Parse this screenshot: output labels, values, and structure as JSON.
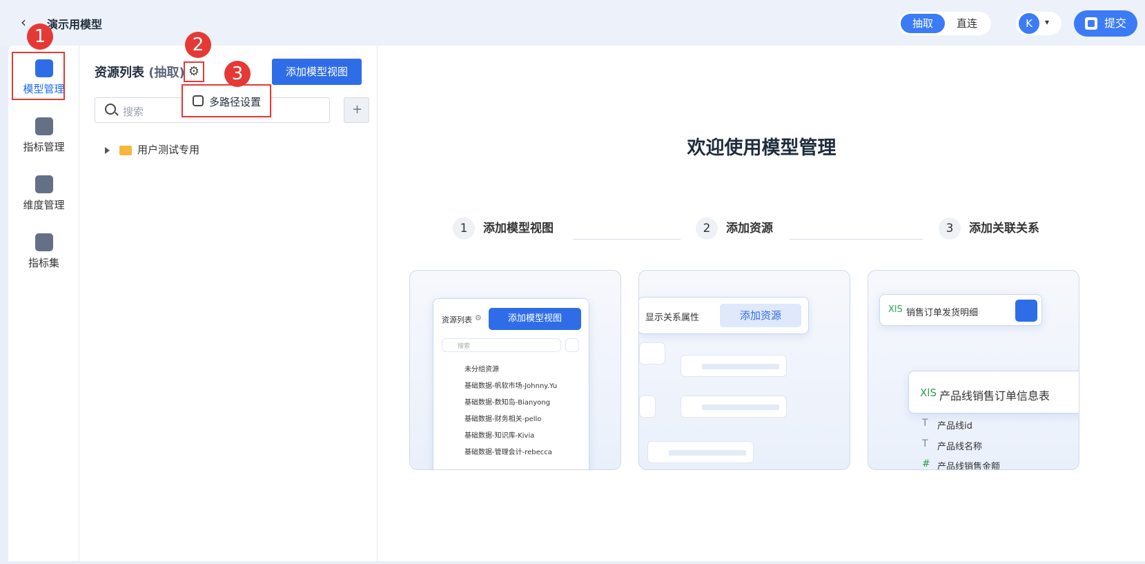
{
  "topbar": {
    "back_icon": "chevron-left-icon",
    "title": "演示用模型",
    "mode_options": [
      "抽取",
      "直连"
    ],
    "mode_active": "抽取",
    "user_initial": "K",
    "submit_label": "提交"
  },
  "leftnav": [
    {
      "label": "模型管理",
      "icon": "model-icon",
      "active": true
    },
    {
      "label": "指标管理",
      "icon": "chart-icon",
      "active": false
    },
    {
      "label": "维度管理",
      "icon": "dimension-icon",
      "active": false
    },
    {
      "label": "指标集",
      "icon": "cube-icon",
      "active": false
    }
  ],
  "panel": {
    "title": "资源列表",
    "title_sub": "(抽取)",
    "add_button": "添加模型视图",
    "search_placeholder": "搜索",
    "tree": [
      {
        "label": "用户测试专用",
        "expanded": false
      }
    ],
    "menu_item": "多路径设置"
  },
  "badges": [
    "1",
    "2",
    "3"
  ],
  "main": {
    "welcome": "欢迎使用模型管理",
    "steps": [
      {
        "num": "1",
        "label": "添加模型视图"
      },
      {
        "num": "2",
        "label": "添加资源"
      },
      {
        "num": "3",
        "label": "添加关联关系"
      }
    ],
    "card1": {
      "title": "资源列表",
      "btn": "添加模型视图",
      "search_ph": "搜索",
      "rows": [
        "未分组资源",
        "基础数据-帆软市场-Johnny.Yu",
        "基础数据-数知岛-Bianyong",
        "基础数据-财务相关-pello",
        "基础数据-知识库-Kivia",
        "基础数据-管理会计-rebecca"
      ]
    },
    "card2": {
      "label": "显示关系属性",
      "btn": "添加资源"
    },
    "card3": {
      "source": "销售订单发货明细",
      "target": "产品线销售订单信息表",
      "xls_tag": "XlS",
      "fields": [
        {
          "name": "产品线id",
          "type": "T"
        },
        {
          "name": "产品线名称",
          "type": "T"
        },
        {
          "name": "产品线销售金额",
          "type": "#"
        }
      ]
    }
  },
  "colors": {
    "primary": "#2f6de8",
    "badge": "#e53935",
    "folder": "#f6b73c"
  }
}
